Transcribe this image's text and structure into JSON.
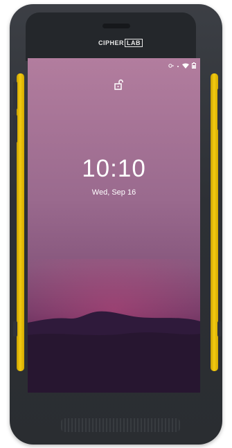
{
  "device": {
    "brand_prefix": "CIPHER",
    "brand_suffix": "LAB"
  },
  "status_bar": {
    "icons": [
      "vpn-key-icon",
      "dot-icon",
      "wifi-icon",
      "battery-icon"
    ]
  },
  "lock_screen": {
    "lock_icon": "unlocked-padlock-icon",
    "time": "10:10",
    "date": "Wed, Sep 16"
  },
  "colors": {
    "bumper": "#f3cb12",
    "body": "#2d3035",
    "wallpaper_top": "#b27d9e",
    "wallpaper_bottom": "#3a1a3e"
  }
}
